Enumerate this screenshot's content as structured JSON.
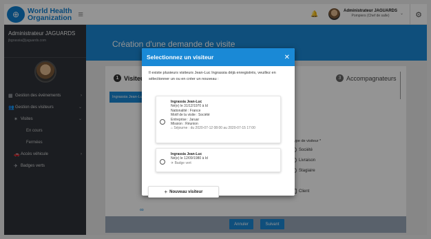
{
  "sidebar": {
    "logo_line1": "World Health",
    "logo_line2": "Organization",
    "user_name": "Administrateur JAGUARDS",
    "user_email": "jbgrassia@jaguards.com",
    "items": [
      {
        "label": "Gestion des événements",
        "icon": "calendar-icon"
      },
      {
        "label": "Gestion des visiteurs",
        "icon": "users-icon"
      },
      {
        "label": "Visites",
        "icon": "walk-icon"
      },
      {
        "label": "En cours"
      },
      {
        "label": "Fermées"
      },
      {
        "label": "Accès véhicule",
        "icon": "car-icon"
      },
      {
        "label": "Badges verts",
        "icon": "plane-icon"
      }
    ]
  },
  "topbar": {
    "user_name": "Administrateur JAGUARDS",
    "user_role": "Pompiers (Chef de salle)"
  },
  "main": {
    "title": "Création d'une demande de visite",
    "step1_label": "Visiteur",
    "step1_num": "1",
    "step3_label": "Accompagnateurs",
    "step3_num": "3",
    "tab_label": "Ingrassia Jean-Luc",
    "type_label": "Type de visiteur *",
    "type_options": [
      "Société",
      "Livraison",
      "Stagiaire"
    ],
    "client_option": "Client",
    "cancel_button": "Annuler",
    "next_button": "Suivant"
  },
  "modal": {
    "title": "Selectionnez un visiteur",
    "message": "Il existe plusieurs visiteurs Jean-Luc Ingrassia déjà enregistrés, veuillez en sélectionner un ou en créer un nouveau :",
    "visitors": [
      {
        "name": "Ingrassia Jean-Luc",
        "born": "Né(e) le 31/12/1970 à Id",
        "nationality": "Nationalité : France",
        "motif": "Motif de la visite : Société",
        "company": "Entreprise : Jaruar",
        "mission": "Mission : Réunion",
        "stay": "Séjourne : du 2020-07-12 08:00 au 2020-07-15 17:00"
      },
      {
        "name": "Ingrassia Jean-Luc",
        "born": "Né(e) le 12/09/1980 à Id",
        "badge": "Badge vert"
      }
    ],
    "new_button": "Nouveau visiteur"
  },
  "colors": {
    "primary": "#1a89d6",
    "sidebar": "#2f333a"
  }
}
